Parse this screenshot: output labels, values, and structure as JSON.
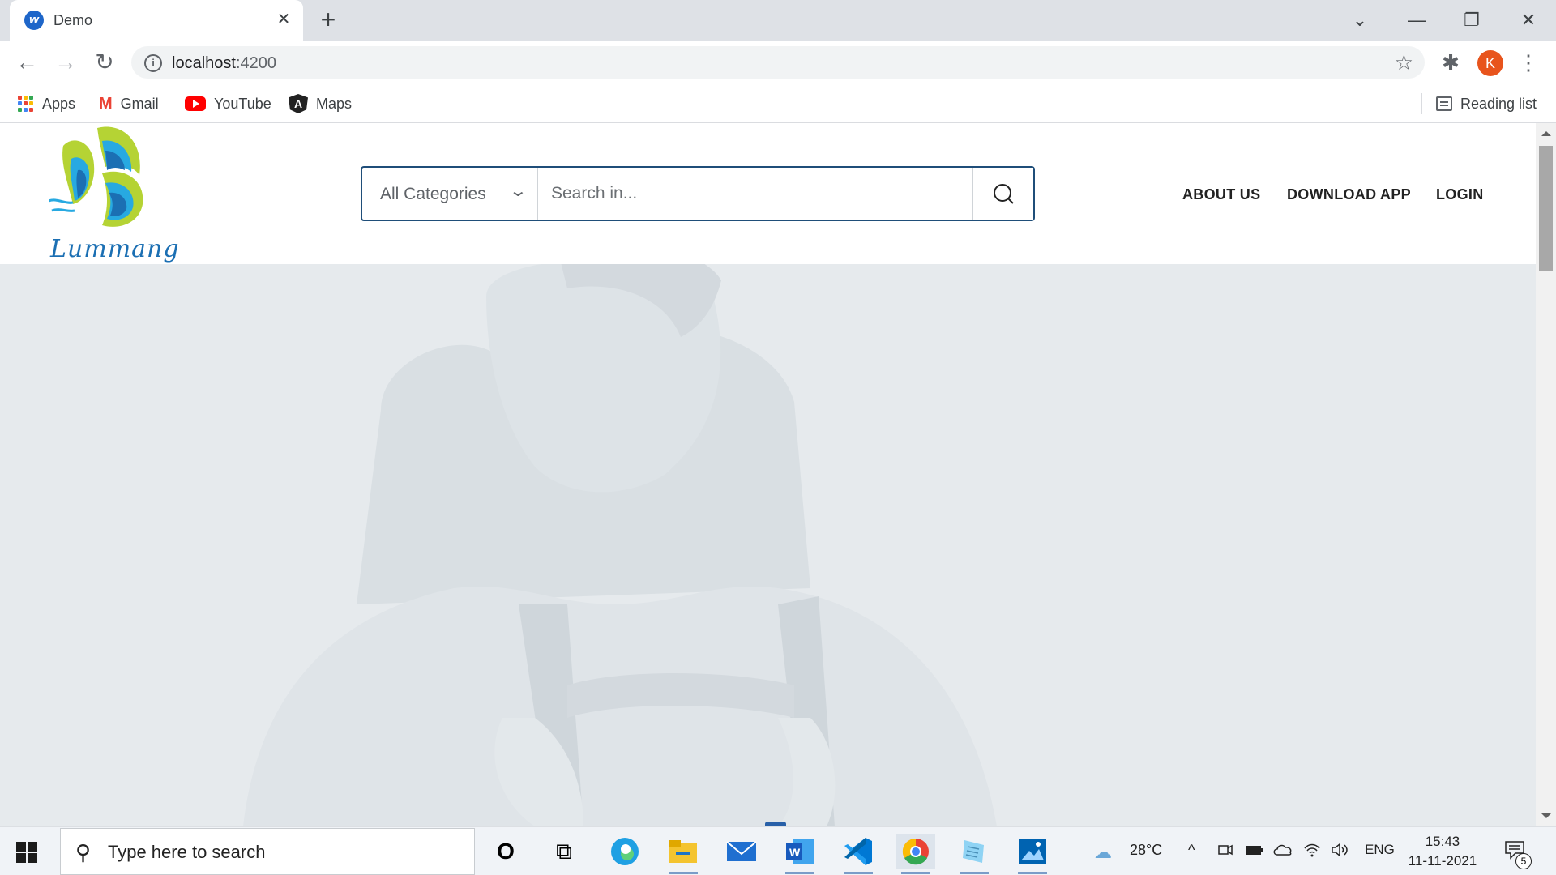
{
  "browser": {
    "tab": {
      "title": "Demo",
      "close_glyph": "✕"
    },
    "new_tab_glyph": "+",
    "window_controls": {
      "tab_search": "⌄",
      "minimize": "—",
      "restore": "❐",
      "close": "✕"
    },
    "toolbar": {
      "back": "←",
      "forward": "→",
      "reload": "↻",
      "url_host": "localhost",
      "url_port": ":4200",
      "info_glyph": "i",
      "star_glyph": "☆",
      "extensions_glyph": "✱",
      "profile_initial": "K",
      "menu_glyph": "⋮"
    },
    "bookmarks": {
      "items": [
        {
          "label": "Apps"
        },
        {
          "label": "Gmail"
        },
        {
          "label": "YouTube"
        },
        {
          "label": "Maps"
        }
      ],
      "gmail_glyph": "M",
      "maps_glyph": "A",
      "reading_list": "Reading list"
    }
  },
  "site": {
    "logo_text": "Lummang",
    "search": {
      "category": "All Categories",
      "caret": "⌄",
      "placeholder": "Search in..."
    },
    "nav": [
      {
        "label": "ABOUT US"
      },
      {
        "label": "DOWNLOAD APP"
      },
      {
        "label": "LOGIN"
      }
    ],
    "hero": {
      "slide_count": 2,
      "active_slide": 2
    }
  },
  "taskbar": {
    "search_placeholder": "Type here to search",
    "search_glyph": "⚲",
    "cortana_glyph": "O",
    "taskview_glyph": "⧉",
    "weather_temp": "28°C",
    "weather_glyph": "☁",
    "tray_chevron": "^",
    "battery_glyph": "▭",
    "cloud_glyph": "☁",
    "wifi_glyph": "◠",
    "volume_glyph": "◁)",
    "language": "ENG",
    "time": "15:43",
    "date": "11-11-2021",
    "notification_glyph": "▭",
    "notification_count": "5"
  },
  "colors": {
    "accent": "#1f4e79",
    "hero_bg": "#e6eaed",
    "profile": "#e8541c",
    "logo_green": "#b5d334",
    "logo_blue": "#1b6fb3",
    "logo_cyan": "#27a9e1"
  }
}
